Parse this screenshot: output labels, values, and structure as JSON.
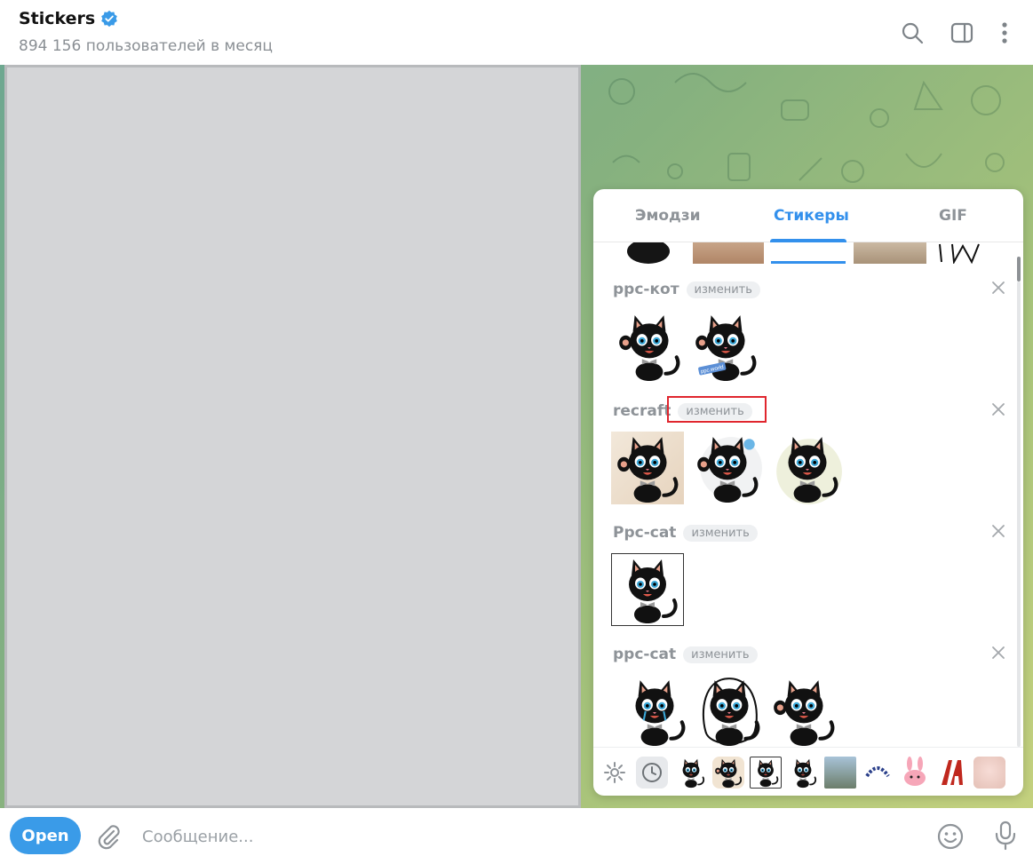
{
  "header": {
    "title": "Stickers",
    "subtitle": "894 156 пользователей в месяц"
  },
  "panel": {
    "tabs": [
      {
        "label": "Эмодзи",
        "active": false
      },
      {
        "label": "Стикеры",
        "active": true
      },
      {
        "label": "GIF",
        "active": false
      }
    ],
    "edit_label": "изменить",
    "sets": [
      {
        "name": "ppc-кот",
        "sticker_count": 2
      },
      {
        "name": "recraft",
        "sticker_count": 3
      },
      {
        "name": "Ppc-cat",
        "sticker_count": 1
      },
      {
        "name": "ppc-cat",
        "sticker_count": 3
      }
    ],
    "sticker_badge_text": "ppc.world",
    "setbar_icons": [
      "settings-icon",
      "recent-clock-icon",
      "sticker-set-thumb",
      "sticker-set-thumb",
      "sticker-set-thumb",
      "sticker-set-thumb",
      "sticker-set-thumb",
      "sticker-set-thumb",
      "sticker-set-thumb",
      "sticker-set-thumb",
      "sticker-set-thumb"
    ]
  },
  "composer": {
    "open_button": "Open",
    "placeholder": "Сообщение..."
  },
  "colors": {
    "accent": "#3390ec",
    "open_button": "#3a9be8",
    "highlight_box": "#e0262e"
  }
}
